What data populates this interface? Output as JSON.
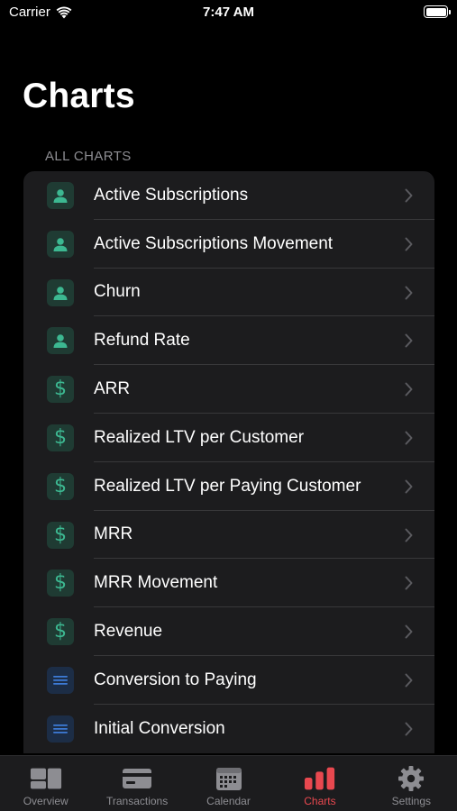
{
  "status_bar": {
    "carrier": "Carrier",
    "time": "7:47 AM"
  },
  "page": {
    "title": "Charts",
    "section_header": "ALL CHARTS"
  },
  "colors": {
    "accent_active_tab": "#e8484f",
    "icon_green": "#3cb891",
    "icon_blue": "#3d7bd6"
  },
  "charts": [
    {
      "label": "Active Subscriptions",
      "icon": "person-icon"
    },
    {
      "label": "Active Subscriptions Movement",
      "icon": "person-icon"
    },
    {
      "label": "Churn",
      "icon": "person-icon"
    },
    {
      "label": "Refund Rate",
      "icon": "person-icon"
    },
    {
      "label": "ARR",
      "icon": "dollar-icon"
    },
    {
      "label": "Realized LTV per Customer",
      "icon": "dollar-icon"
    },
    {
      "label": "Realized LTV per Paying Customer",
      "icon": "dollar-icon"
    },
    {
      "label": "MRR",
      "icon": "dollar-icon"
    },
    {
      "label": "MRR Movement",
      "icon": "dollar-icon"
    },
    {
      "label": "Revenue",
      "icon": "dollar-icon"
    },
    {
      "label": "Conversion to Paying",
      "icon": "lines-icon"
    },
    {
      "label": "Initial Conversion",
      "icon": "lines-icon"
    }
  ],
  "tabs": [
    {
      "label": "Overview",
      "icon": "overview-icon",
      "active": false
    },
    {
      "label": "Transactions",
      "icon": "card-icon",
      "active": false
    },
    {
      "label": "Calendar",
      "icon": "calendar-icon",
      "active": false
    },
    {
      "label": "Charts",
      "icon": "bar-chart-icon",
      "active": true
    },
    {
      "label": "Settings",
      "icon": "gear-icon",
      "active": false
    }
  ]
}
